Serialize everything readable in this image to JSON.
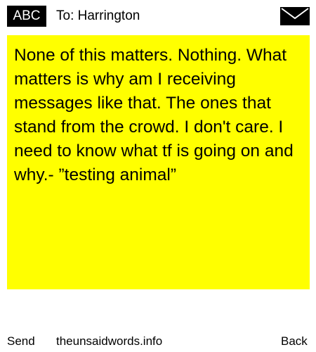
{
  "header": {
    "input_mode": "ABC",
    "to_line": "To: Harrington",
    "icon": "envelope-icon"
  },
  "message": {
    "text": "None of this matters. Nothing. What matters is why am I receiving messages like that. The ones that stand from the crowd. I don't care. I need to know what tf is going on and why.- ”testing animal”",
    "background": "#ffff00"
  },
  "footer": {
    "send_label": "Send",
    "site_label": "theunsaidwords.info",
    "back_label": "Back"
  }
}
